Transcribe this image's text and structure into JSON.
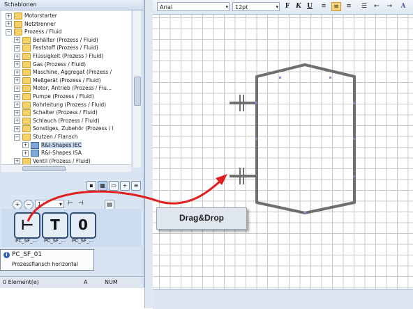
{
  "panel": {
    "title": "Schablonen",
    "tree": [
      {
        "label": "Motorstarter",
        "type": "folder",
        "indent": 1,
        "pm": "+"
      },
      {
        "label": "Netztrenner",
        "type": "folder",
        "indent": 1,
        "pm": "+"
      },
      {
        "label": "Prozess / Fluid",
        "type": "folder",
        "indent": 1,
        "pm": "−"
      },
      {
        "label": "Behälter (Prozess / Fluid)",
        "type": "folder",
        "indent": 2,
        "pm": "+"
      },
      {
        "label": "Feststoff (Prozess / Fluid)",
        "type": "folder",
        "indent": 2,
        "pm": "+"
      },
      {
        "label": "Flüssigkeit (Prozess / Fluid)",
        "type": "folder",
        "indent": 2,
        "pm": "+"
      },
      {
        "label": "Gas (Prozess / Fluid)",
        "type": "folder",
        "indent": 2,
        "pm": "+"
      },
      {
        "label": "Maschine, Aggregat (Prozess /",
        "type": "folder",
        "indent": 2,
        "pm": "+"
      },
      {
        "label": "Meßgerät (Prozess / Fluid)",
        "type": "folder",
        "indent": 2,
        "pm": "+"
      },
      {
        "label": "Motor, Antrieb (Prozess / Flu...",
        "type": "folder",
        "indent": 2,
        "pm": "+"
      },
      {
        "label": "Pumpe (Prozess / Fluid)",
        "type": "folder",
        "indent": 2,
        "pm": "+"
      },
      {
        "label": "Rohrleitung (Prozess / Fluid)",
        "type": "folder",
        "indent": 2,
        "pm": "+"
      },
      {
        "label": "Schalter (Prozess / Fluid)",
        "type": "folder",
        "indent": 2,
        "pm": "+"
      },
      {
        "label": "Schlauch (Prozess / Fluid)",
        "type": "folder",
        "indent": 2,
        "pm": "+"
      },
      {
        "label": "Sonstiges, Zubehör (Prozess / I",
        "type": "folder",
        "indent": 2,
        "pm": "+"
      },
      {
        "label": "Stutzen / Flansch",
        "type": "folder",
        "indent": 2,
        "pm": "−"
      },
      {
        "label": "R&I-Shapes IEC",
        "type": "shapes",
        "indent": 3,
        "pm": "+",
        "selected": true
      },
      {
        "label": "R&I-Shapes ISA",
        "type": "shapes",
        "indent": 3,
        "pm": "+"
      },
      {
        "label": "Ventil (Prozess / Fluid)",
        "type": "folder",
        "indent": 2,
        "pm": "+"
      }
    ],
    "zoom_value": "1",
    "shapes": [
      {
        "glyph": "⊢",
        "label": "PC_SF_..."
      },
      {
        "glyph": "T",
        "label": "PC_SF_..."
      },
      {
        "glyph": "0",
        "label": "PC_SF_..."
      }
    ],
    "tooltip": {
      "title": "PC_SF_01",
      "text": "Prozessflansch horizontal"
    },
    "status": {
      "elements": "0 Element(e)",
      "a": "A",
      "num": "NUM"
    }
  },
  "toolbar": {
    "font": "Arial",
    "size": "12pt",
    "bold": "F",
    "italic": "K",
    "underline": "U"
  },
  "drag_label": "Drag&Drop",
  "colors": {
    "accent_arrow": "#e02020",
    "vessel": "#6f6f6f",
    "folder": "#f4d169"
  }
}
